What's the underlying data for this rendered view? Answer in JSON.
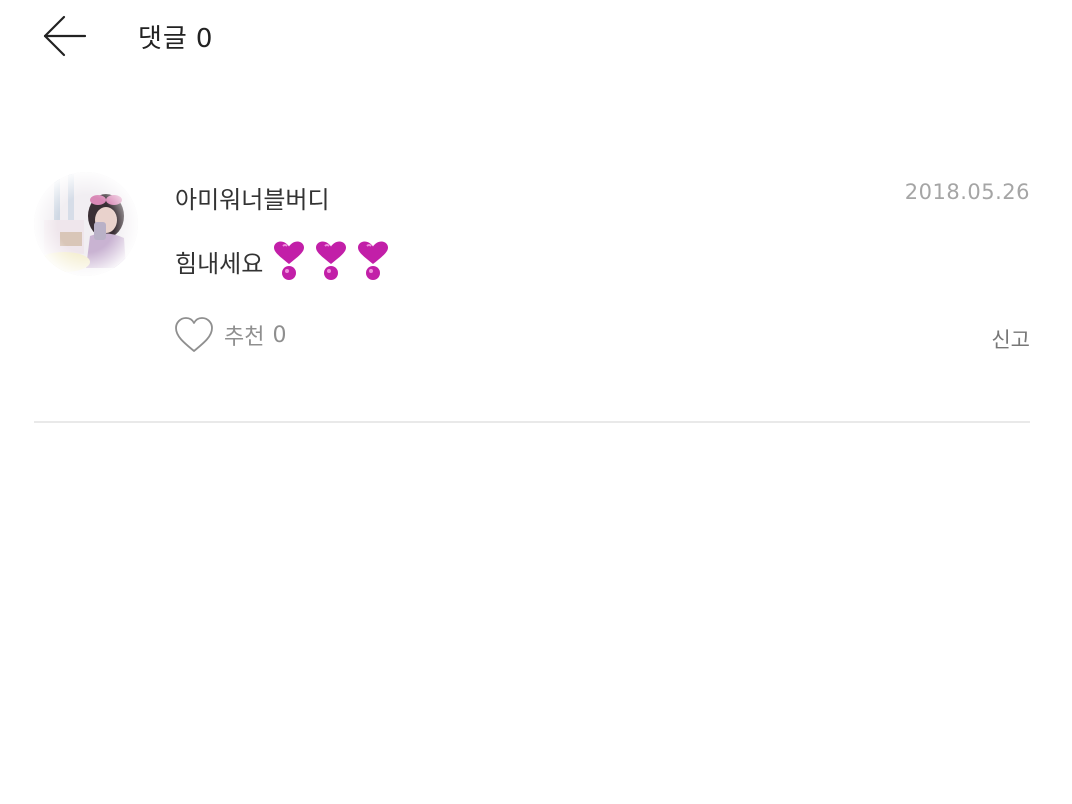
{
  "header": {
    "title": "댓글",
    "count": "0"
  },
  "comment": {
    "author": "아미워너블버디",
    "date": "2018.05.26",
    "text": "힘내세요",
    "emojis": [
      "heart-exclamation-icon",
      "heart-exclamation-icon",
      "heart-exclamation-icon"
    ],
    "like_label": "추천",
    "like_count": "0",
    "report_label": "신고"
  },
  "colors": {
    "text_primary": "#333333",
    "text_muted": "#a5a5a5",
    "emoji_magenta": "#c21fa8",
    "divider": "#e9e9e9"
  }
}
